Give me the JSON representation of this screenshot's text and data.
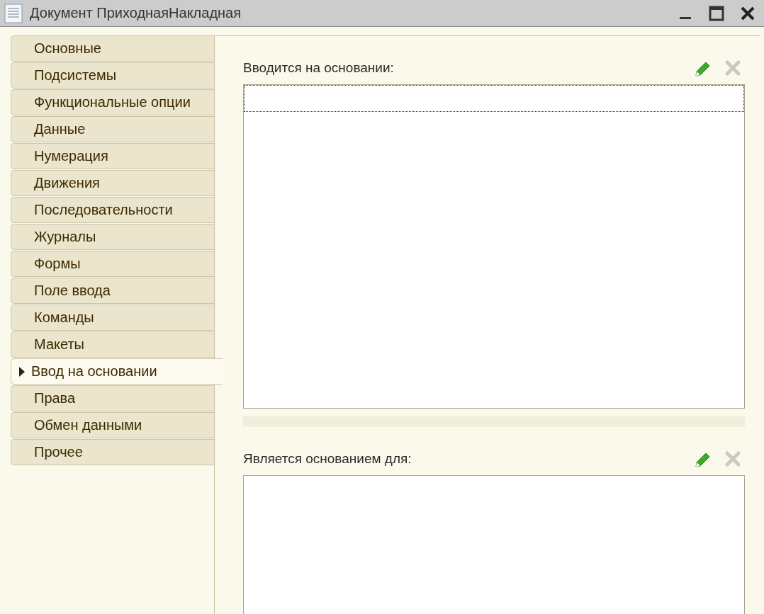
{
  "window": {
    "title": "Документ ПриходнаяНакладная"
  },
  "tabs": [
    {
      "label": "Основные",
      "selected": false
    },
    {
      "label": "Подсистемы",
      "selected": false
    },
    {
      "label": "Функциональные опции",
      "selected": false
    },
    {
      "label": "Данные",
      "selected": false
    },
    {
      "label": "Нумерация",
      "selected": false
    },
    {
      "label": "Движения",
      "selected": false
    },
    {
      "label": "Последовательности",
      "selected": false
    },
    {
      "label": "Журналы",
      "selected": false
    },
    {
      "label": "Формы",
      "selected": false
    },
    {
      "label": "Поле ввода",
      "selected": false
    },
    {
      "label": "Команды",
      "selected": false
    },
    {
      "label": "Макеты",
      "selected": false
    },
    {
      "label": "Ввод на основании",
      "selected": true
    },
    {
      "label": "Права",
      "selected": false
    },
    {
      "label": "Обмен данными",
      "selected": false
    },
    {
      "label": "Прочее",
      "selected": false
    }
  ],
  "sections": [
    {
      "label": "Вводится на основании:",
      "delete_disabled": true,
      "has_current_row": true
    },
    {
      "label": "Является основанием для:",
      "delete_disabled": true,
      "has_current_row": false
    }
  ]
}
